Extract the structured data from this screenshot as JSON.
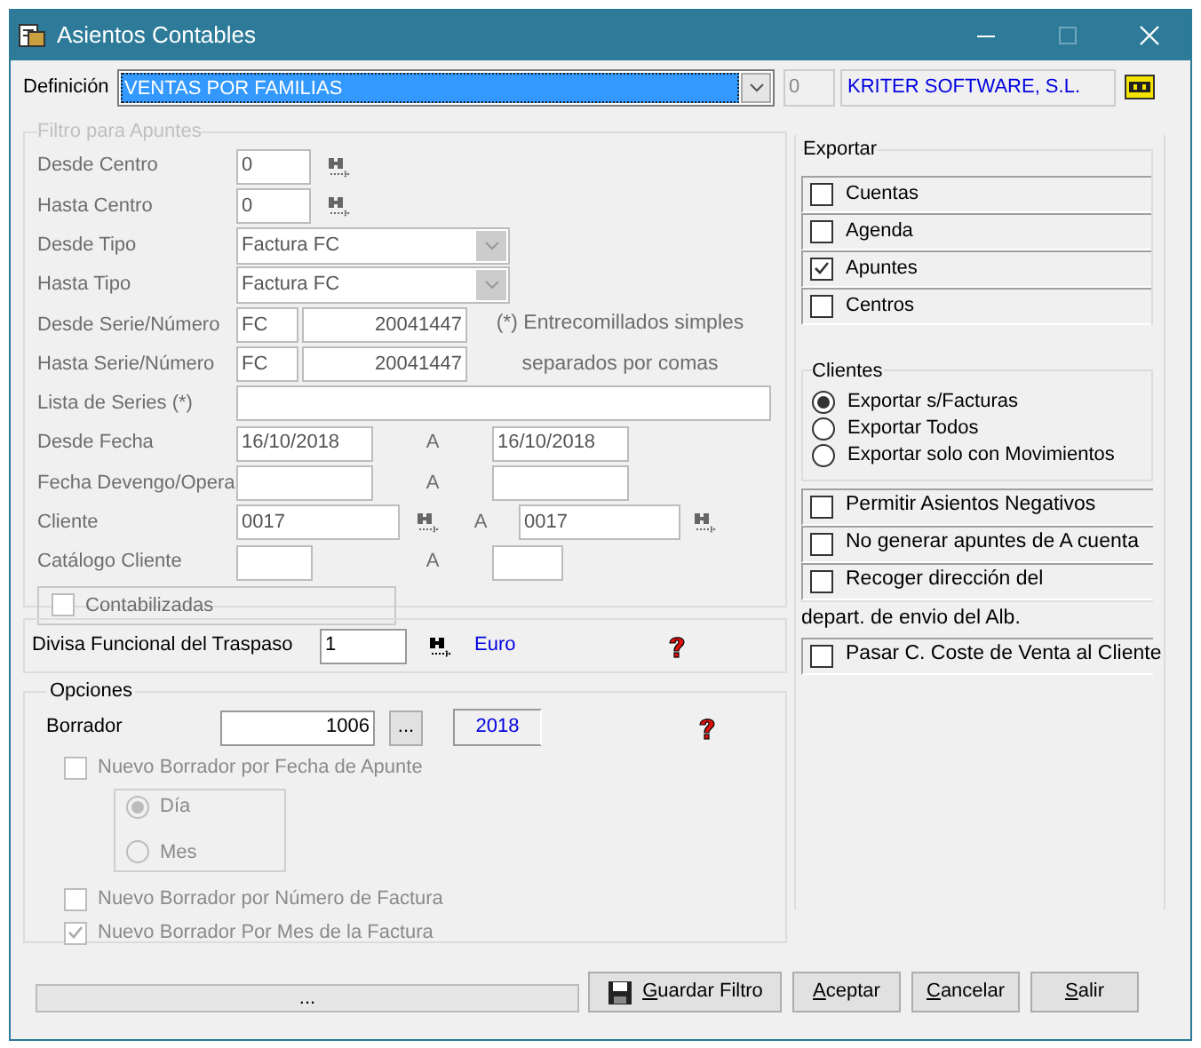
{
  "window": {
    "title": "Asientos Contables"
  },
  "definition": {
    "label": "Definición",
    "value": "VENTAS POR FAMILIAS",
    "code": "0",
    "company": "KRITER SOFTWARE, S.L."
  },
  "filter": {
    "legend": "Filtro para Apuntes",
    "disabled": true,
    "rows": [
      {
        "kind": "lookup",
        "label": "Desde Centro",
        "value": "0"
      },
      {
        "kind": "lookup",
        "label": "Hasta Centro",
        "value": "0"
      },
      {
        "kind": "select",
        "label": "Desde Tipo",
        "value": "Factura FC"
      },
      {
        "kind": "select",
        "label": "Hasta Tipo",
        "value": "Factura FC"
      },
      {
        "kind": "serie",
        "label": "Desde Serie/Número",
        "serie": "FC",
        "number": "20041447",
        "note": "(*) Entrecomillados simples"
      },
      {
        "kind": "serie",
        "label": "Hasta Serie/Número",
        "serie": "FC",
        "number": "20041447",
        "note": "separados por comas"
      },
      {
        "kind": "text",
        "label": "Lista de Series (*)"
      },
      {
        "kind": "range",
        "label": "Desde Fecha",
        "from": "16/10/2018",
        "sep": "A",
        "to": "16/10/2018"
      },
      {
        "kind": "range",
        "label": "Fecha Devengo/Opera",
        "sep": "A"
      },
      {
        "kind": "range_lookup",
        "label": "Cliente",
        "from": "0017",
        "sep": "A",
        "to": "0017"
      },
      {
        "kind": "range_small",
        "label": "Catálogo Cliente",
        "sep": "A"
      }
    ],
    "contabilizadas": {
      "label": "Contabilizadas",
      "checked": false,
      "disabled": true
    }
  },
  "divisa": {
    "label": "Divisa Funcional del Traspaso",
    "value": "1",
    "currency": "Euro"
  },
  "options": {
    "legend": "Opciones",
    "borrador": {
      "label": "Borrador",
      "value": "1006",
      "button": "...",
      "year": "2018"
    },
    "by_date": {
      "label": "Nuevo Borrador por Fecha de Apunte",
      "checked": false,
      "disabled": true
    },
    "period": [
      {
        "label": "Día",
        "selected": true,
        "disabled": true
      },
      {
        "label": "Mes",
        "selected": false,
        "disabled": true
      }
    ],
    "more": [
      {
        "label": "Nuevo Borrador por Número de Factura",
        "checked": false,
        "disabled": true
      },
      {
        "label": "Nuevo Borrador Por Mes de la Factura",
        "checked": true,
        "disabled": true
      }
    ]
  },
  "export": {
    "legend": "Exportar",
    "items": [
      {
        "label": "Cuentas",
        "checked": false
      },
      {
        "label": "Agenda",
        "checked": false
      },
      {
        "label": "Apuntes",
        "checked": true
      },
      {
        "label": "Centros",
        "checked": false
      }
    ]
  },
  "clientes": {
    "legend": "Clientes",
    "options": [
      {
        "label": "Exportar s/Facturas",
        "selected": true
      },
      {
        "label": "Exportar Todos",
        "selected": false
      },
      {
        "label": "Exportar solo con Movimientos",
        "selected": false
      }
    ]
  },
  "extra": [
    {
      "kind": "checkbox",
      "label": "Permitir Asientos Negativos",
      "checked": false
    },
    {
      "kind": "checkbox",
      "label": "No generar apuntes de A cuenta",
      "checked": false
    },
    {
      "kind": "checkbox",
      "label": "Recoger dirección del",
      "checked": false
    },
    {
      "kind": "text",
      "label": "depart. de envio del Alb."
    },
    {
      "kind": "checkbox",
      "label": "Pasar C. Coste de Venta al Cliente",
      "checked": false
    }
  ],
  "status": "...",
  "buttons": [
    {
      "kind": "save",
      "label": "Guardar Filtro"
    },
    {
      "kind": "plain",
      "label": "Aceptar"
    },
    {
      "kind": "plain",
      "label": "Cancelar"
    },
    {
      "kind": "plain",
      "label": "Salir"
    }
  ]
}
